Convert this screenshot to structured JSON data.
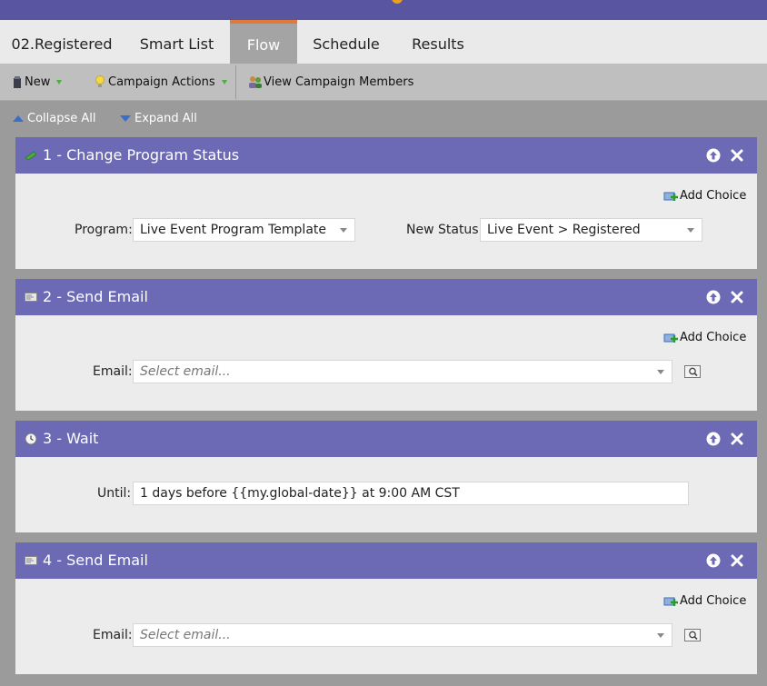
{
  "tabs": [
    {
      "label": "02.Registered"
    },
    {
      "label": "Smart List"
    },
    {
      "label": "Flow"
    },
    {
      "label": "Schedule"
    },
    {
      "label": "Results"
    }
  ],
  "toolbar": {
    "new_label": "New",
    "campaign_actions_label": "Campaign Actions",
    "view_members_label": "View Campaign Members"
  },
  "flow_controls": {
    "collapse_label": "Collapse All",
    "expand_label": "Expand All"
  },
  "steps": [
    {
      "title": "1 - Change Program Status",
      "icon": "status-change-icon",
      "add_choice": "Add Choice",
      "program_label": "Program:",
      "program_value": "Live Event Program Template",
      "status_label": "New Status:",
      "status_value": "Live Event > Registered"
    },
    {
      "title": "2 - Send Email",
      "icon": "email-icon",
      "add_choice": "Add Choice",
      "email_label": "Email:",
      "email_placeholder": "Select email..."
    },
    {
      "title": "3 - Wait",
      "icon": "clock-icon",
      "until_label": "Until:",
      "until_value": "1 days before {{my.global-date}} at 9:00 AM CST"
    },
    {
      "title": "4 - Send Email",
      "icon": "email-icon",
      "add_choice": "Add Choice",
      "email_label": "Email:",
      "email_placeholder": "Select email..."
    }
  ],
  "colors": {
    "header_purple": "#5a55a0",
    "step_header": "#6c69b5",
    "active_tab_accent": "#e07a3a"
  }
}
